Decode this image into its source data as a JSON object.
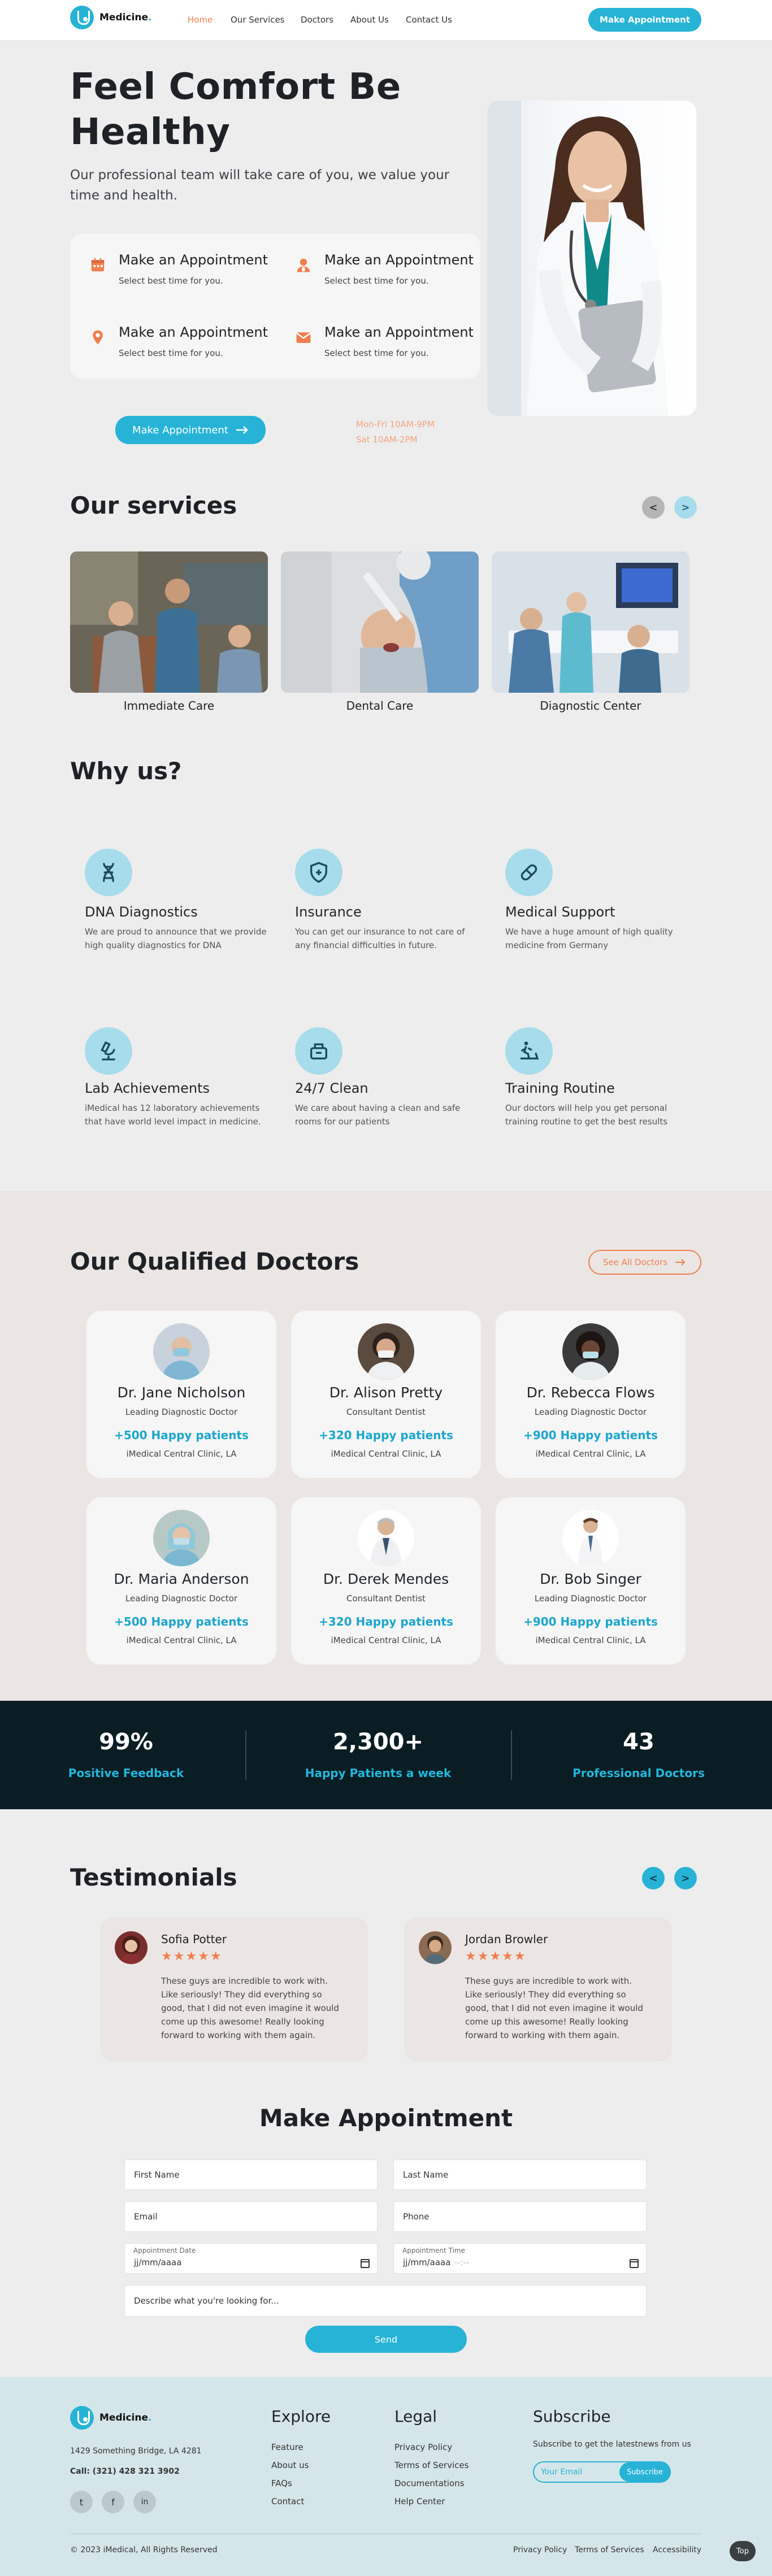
{
  "brand": {
    "name": "Medicine",
    "dot": "."
  },
  "nav": {
    "links": [
      "Home",
      "Our Services",
      "Doctors",
      "About Us",
      "Contact Us"
    ],
    "cta": "Make Appointment"
  },
  "hero": {
    "title_line1": "Feel Comfort Be",
    "title_line2": "Healthy",
    "subtitle": "Our professional team will take care of you, we value your time and health.",
    "appointments": [
      {
        "title": "Make an Appointment",
        "sub": "Select best time for you.",
        "icon": "calendar-icon"
      },
      {
        "title": "Make an Appointment",
        "sub": "Select best time for you.",
        "icon": "doctor-icon"
      },
      {
        "title": "Make an Appointment",
        "sub": "Select best time for you.",
        "icon": "location-icon"
      },
      {
        "title": "Make an Appointment",
        "sub": "Select best time for you.",
        "icon": "mail-icon"
      }
    ],
    "cta": "Make Appointment",
    "hours_line1": "Mon-Fri 10AM-9PM",
    "hours_line2": "Sat 10AM-2PM"
  },
  "services": {
    "title": "Our services",
    "prev": "<",
    "next": ">",
    "items": [
      "Immediate Care",
      "Dental Care",
      "Diagnostic Center"
    ]
  },
  "why": {
    "title": "Why us?",
    "items": [
      {
        "title": "DNA Diagnostics",
        "text": "We are proud to announce that we provide high quality diagnostics for DNA",
        "icon": "dna-icon"
      },
      {
        "title": "Insurance",
        "text": "You can get our insurance to not care of any financial difficulties in future.",
        "icon": "shield-icon"
      },
      {
        "title": "Medical Support",
        "text": "We have a huge amount of high quality medicine from Germany",
        "icon": "pill-icon"
      },
      {
        "title": "Lab Achievements",
        "text": "iMedical has 12 laboratory achievements that have world level impact in medicine.",
        "icon": "microscope-icon"
      },
      {
        "title": "24/7 Clean",
        "text": "We care about having a clean and safe rooms for our patients",
        "icon": "cleaning-icon"
      },
      {
        "title": "Training Routine",
        "text": "Our doctors will help you get personal training routine to get the best results",
        "icon": "treadmill-icon"
      }
    ]
  },
  "doctors": {
    "title": "Our Qualified Doctors",
    "see_all": "See All Doctors",
    "items": [
      {
        "name": "Dr. Jane Nicholson",
        "role": "Leading Diagnostic Doctor",
        "patients": "+500 Happy patients",
        "clinic": "iMedical Central Clinic, LA"
      },
      {
        "name": "Dr. Alison Pretty",
        "role": "Consultant Dentist",
        "patients": "+320 Happy patients",
        "clinic": "iMedical Central Clinic, LA"
      },
      {
        "name": "Dr. Rebecca Flows",
        "role": "Leading Diagnostic Doctor",
        "patients": "+900 Happy patients",
        "clinic": "iMedical Central Clinic, LA"
      },
      {
        "name": "Dr. Maria Anderson",
        "role": "Leading Diagnostic Doctor",
        "patients": "+500 Happy patients",
        "clinic": "iMedical Central Clinic, LA"
      },
      {
        "name": "Dr. Derek Mendes",
        "role": "Consultant Dentist",
        "patients": "+320 Happy patients",
        "clinic": "iMedical Central Clinic, LA"
      },
      {
        "name": "Dr. Bob Singer",
        "role": "Leading Diagnostic Doctor",
        "patients": "+900 Happy patients",
        "clinic": "iMedical Central Clinic, LA"
      }
    ]
  },
  "stats": [
    {
      "value": "99%",
      "label": "Positive Feedback"
    },
    {
      "value": "2,300+",
      "label": "Happy Patients a week"
    },
    {
      "value": "43",
      "label": "Professional Doctors"
    }
  ],
  "testimonials": {
    "title": "Testimonials",
    "prev": "<",
    "next": ">",
    "items": [
      {
        "name": "Sofia Potter",
        "stars": "★★★★★",
        "text": "These guys are incredible to work with. Like seriously! They did everything so good, that I did not even imagine it would come up this awesome! Really looking forward to working with them again."
      },
      {
        "name": "Jordan Browler",
        "stars": "★★★★★",
        "text": "These guys are incredible to work with. Like seriously! They did everything so good, that I did not even imagine it would come up this awesome! Really looking forward to working with them again."
      }
    ]
  },
  "form": {
    "title": "Make Appointment",
    "first_name": "First Name",
    "last_name": "Last Name",
    "email": "Email",
    "phone": "Phone",
    "date_label": "Appointment Date",
    "date_value": "jj/mm/aaaa",
    "time_label": "Appointment Time",
    "time_value": "jj/mm/aaaa",
    "time_suffix": "--:--",
    "message": "Describe what you're looking for...",
    "submit": "Send"
  },
  "footer": {
    "address": "1429 Something Bridge, LA 4281",
    "call": "Call: (321) 428 321 3902",
    "explore_title": "Explore",
    "explore": [
      "Feature",
      "About us",
      "FAQs",
      "Contact"
    ],
    "legal_title": "Legal",
    "legal": [
      "Privacy Policy",
      "Terms of Services",
      "Documentations",
      "Help Center"
    ],
    "subscribe_title": "Subscribe",
    "subscribe_text": "Subscribe to get the latestnews from us",
    "email_placeholder": "Your Email",
    "subscribe_btn": "Subscribe",
    "copyright": "© 2023 iMedical, All Rights Reserved",
    "bottom_links": [
      "Privacy Policy",
      "Terms of Services",
      "Accessibility"
    ],
    "top_btn": "Top",
    "socials": [
      "twitter-icon",
      "facebook-icon",
      "linkedin-icon"
    ],
    "social_glyphs": [
      "t",
      "f",
      "in"
    ]
  },
  "colors": {
    "accent": "#26b3d6",
    "orange": "#f07f4f",
    "dark": "#091d23"
  }
}
